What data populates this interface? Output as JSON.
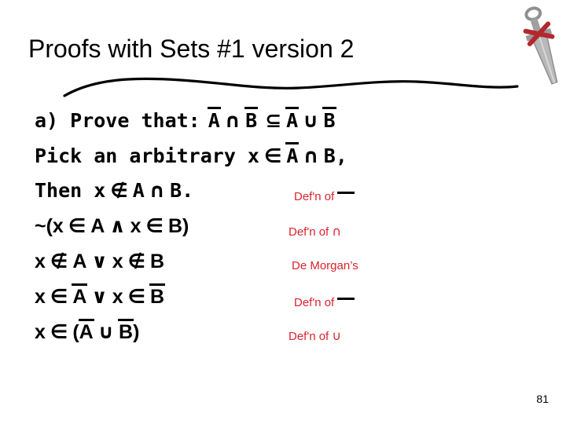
{
  "slide": {
    "title": "Proofs with Sets #1 version 2",
    "page_number": "81",
    "decorations": {
      "squiggle": "hand-drawn-wavy-underline",
      "clipart": "dagger-sword"
    },
    "proof_lines": [
      {
        "id": "line-a",
        "parts": [
          {
            "text": "a) Prove that: ",
            "style": "mono"
          },
          {
            "text": "A",
            "style": "mono-overline"
          },
          {
            "text": " ∩ ",
            "style": "sym"
          },
          {
            "text": "B",
            "style": "mono-overline"
          },
          {
            "text": " ⊆ ",
            "style": "sym"
          },
          {
            "text": "A",
            "style": "mono-overline"
          },
          {
            "text": " ∪ ",
            "style": "sym"
          },
          {
            "text": "B",
            "style": "mono-overline"
          }
        ],
        "plain": "a) Prove that:  A̅ ∩ B̅ ⊆ A̅ ∪ B̅",
        "justification": ""
      },
      {
        "id": "line-pick",
        "plain": "Pick an arbitrary x ∈ A̅ ∩ B,",
        "justification": ""
      },
      {
        "id": "line-then",
        "plain": "Then x ∉ A ∩ B.",
        "justification": "Def'n of ̅",
        "justification_text": "Def'n of",
        "justification_symbol": "overline-bar"
      },
      {
        "id": "line-neg",
        "plain": "~(x ∈ A ∧ x ∈ B)",
        "justification_text": "Def'n of",
        "justification_symbol": "∩"
      },
      {
        "id": "line-demorgan",
        "plain": "x ∉ A ∨ x ∉ B",
        "justification_text": "De Morgan’s",
        "justification_symbol": ""
      },
      {
        "id": "line-compl",
        "plain": "x ∈ A̅ ∨ x ∈ B̅",
        "justification_text": "Def'n of",
        "justification_symbol": "overline-bar"
      },
      {
        "id": "line-union",
        "plain": "x ∈ (A̅ ∪ B̅)",
        "justification_text": "Def'n of",
        "justification_symbol": "∪"
      }
    ],
    "justifications": {
      "j1": "Def'n of",
      "j2": "Def'n of",
      "j3": "De Morgan’s",
      "j4": "Def'n of",
      "j5": "Def'n of",
      "j2_symbol": "∩",
      "j4_symbol": "",
      "j5_symbol": "∪"
    },
    "colors": {
      "text": "#000000",
      "justification": "#d9232e",
      "background": "#ffffff",
      "clipart_body": "#9e9e9e",
      "clipart_accent": "#b3282d"
    }
  }
}
